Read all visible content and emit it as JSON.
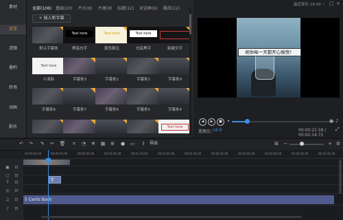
{
  "sidebar": {
    "items": [
      {
        "label": "素材"
      },
      {
        "label": "文字"
      },
      {
        "label": "滤镜"
      },
      {
        "label": "叠附"
      },
      {
        "label": "转场"
      },
      {
        "label": "动画"
      },
      {
        "label": "配乐"
      }
    ],
    "active_index": 1
  },
  "panel": {
    "tabs": [
      {
        "label": "全部(106)"
      },
      {
        "label": "基础(20)"
      },
      {
        "label": "片头(8)"
      },
      {
        "label": "片尾(8)"
      },
      {
        "label": "标题(12)"
      },
      {
        "label": "对话框(6)"
      },
      {
        "label": "酷炫(12)"
      }
    ],
    "insert_button": "插入新字幕",
    "row1": [
      {
        "label": "默认字幕条",
        "inner": ""
      },
      {
        "label": "黑底白字",
        "inner": "Text here"
      },
      {
        "label": "黄色脚注",
        "inner": "Text here"
      },
      {
        "label": "白底黑字",
        "inner": "Text here"
      },
      {
        "label": "新建文字",
        "inner": ""
      }
    ],
    "row2": [
      {
        "label": "小清新",
        "inner": "Text here"
      },
      {
        "label": "字幕条3",
        "inner": ""
      },
      {
        "label": "字幕条2",
        "inner": ""
      },
      {
        "label": "字幕条1",
        "inner": ""
      },
      {
        "label": "字幕条9",
        "inner": ""
      }
    ],
    "row3": [
      {
        "label": "字幕条8"
      },
      {
        "label": "字幕条7"
      },
      {
        "label": "字幕条6"
      },
      {
        "label": "字幕条5"
      },
      {
        "label": "字幕条4"
      }
    ],
    "row4_last_inner": "Text here"
  },
  "preview": {
    "save_status": "最近保存 18:49",
    "caption_text": "祝你每一天都开心愉快！",
    "aspect_label": "宽高比：",
    "aspect_value": "16:9",
    "timecode": "00:00:21.59 / 00:02:14.71"
  },
  "toolbar": {
    "export_label": "导出"
  },
  "timeline": {
    "ticks": [
      "00:00:00.00",
      "00:00:20.00",
      "00:00:40.00",
      "00:01:00.00",
      "00:01:20.00",
      "00:01:40.00",
      "00:02:00.00",
      "00:02:20.00",
      "00:02:40.00",
      "00:03:00.00",
      "00:03:20.00",
      "00:03:40.00"
    ],
    "text_clip_label": "T",
    "audio_clip_label": "5 Cents Back"
  },
  "colors": {
    "accent": "#3a8ee6",
    "active_tab": "#e9a23b",
    "audio_clip": "#4f5b8c",
    "text_clip": "#6c7fb0"
  }
}
